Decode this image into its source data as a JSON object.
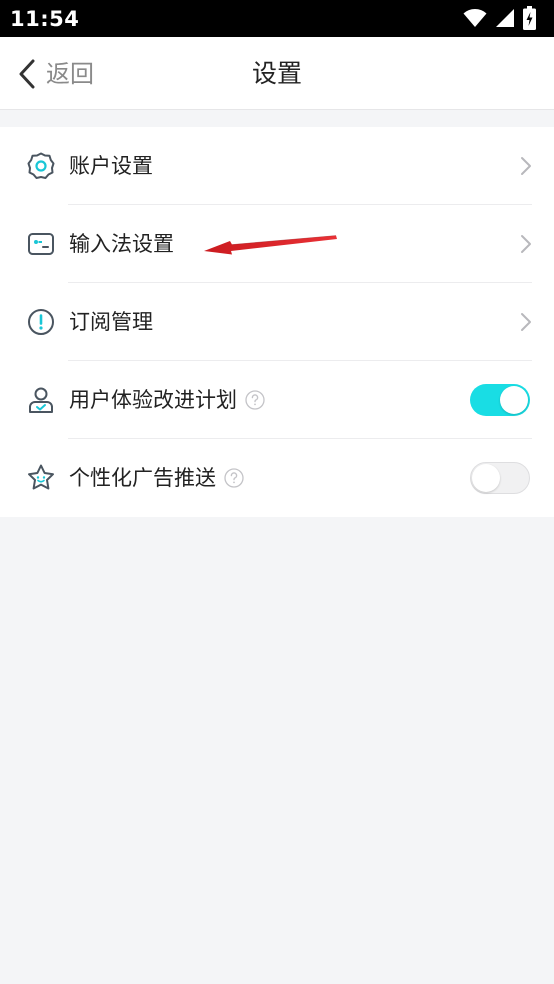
{
  "status_bar": {
    "time": "11:54",
    "icons": [
      "wifi-icon",
      "signal-icon",
      "battery-icon"
    ]
  },
  "nav": {
    "back_label": "返回",
    "title": "设置"
  },
  "settings": {
    "items": [
      {
        "label": "账户设置",
        "icon": "gear-icon",
        "control": "chevron"
      },
      {
        "label": "输入法设置",
        "icon": "keyboard-card-icon",
        "control": "chevron"
      },
      {
        "label": "订阅管理",
        "icon": "exclamation-icon",
        "control": "chevron"
      },
      {
        "label": "用户体验改进计划",
        "icon": "user-check-icon",
        "control": "toggle",
        "help": true,
        "toggle_on": true
      },
      {
        "label": "个性化广告推送",
        "icon": "star-face-icon",
        "control": "toggle",
        "help": true,
        "toggle_on": false
      }
    ]
  },
  "colors": {
    "accent": "#19dde4",
    "icon_stroke": "#4a5560",
    "annotation_arrow": "#d8141a",
    "background": "#f4f5f7"
  }
}
